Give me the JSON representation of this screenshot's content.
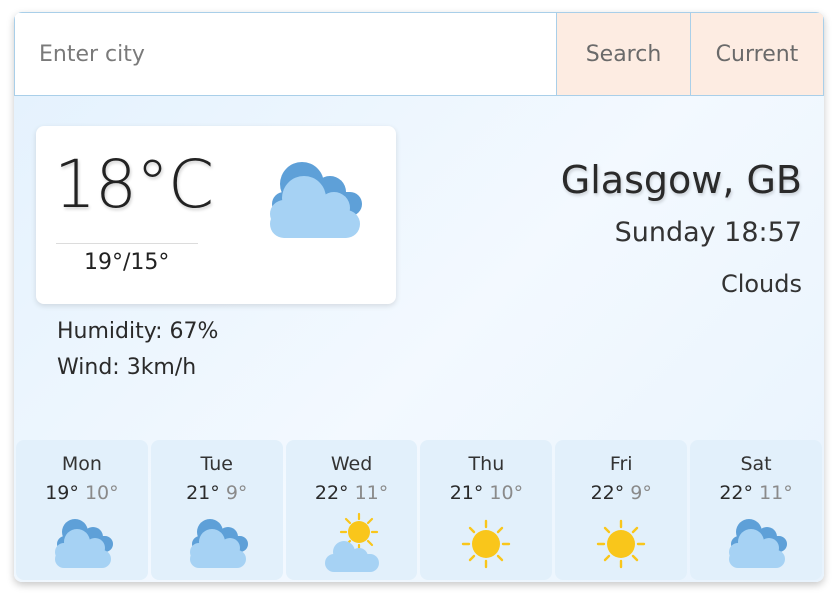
{
  "search": {
    "placeholder": "Enter city",
    "value": "",
    "search_label": "Search",
    "current_label": "Current"
  },
  "current": {
    "temp": "18°C",
    "range": "19°/15°",
    "icon": "clouds-icon",
    "location": "Glasgow, GB",
    "datetime": "Sunday 18:57",
    "condition": "Clouds",
    "humidity": "Humidity: 67%",
    "wind": "Wind: 3km/h"
  },
  "forecast": [
    {
      "day": "Mon",
      "hi": "19°",
      "lo": "10°",
      "icon": "clouds-icon"
    },
    {
      "day": "Tue",
      "hi": "21°",
      "lo": "9°",
      "icon": "clouds-icon"
    },
    {
      "day": "Wed",
      "hi": "22°",
      "lo": "11°",
      "icon": "partly-sunny-icon"
    },
    {
      "day": "Thu",
      "hi": "21°",
      "lo": "10°",
      "icon": "sun-icon"
    },
    {
      "day": "Fri",
      "hi": "22°",
      "lo": "9°",
      "icon": "sun-icon"
    },
    {
      "day": "Sat",
      "hi": "22°",
      "lo": "11°",
      "icon": "clouds-icon"
    }
  ],
  "colors": {
    "cloud_dark": "#5ea0d8",
    "cloud_light": "#a6d2f4",
    "sun": "#f9c61b",
    "button_bg": "#fdece2",
    "border": "#a9cfe9"
  }
}
